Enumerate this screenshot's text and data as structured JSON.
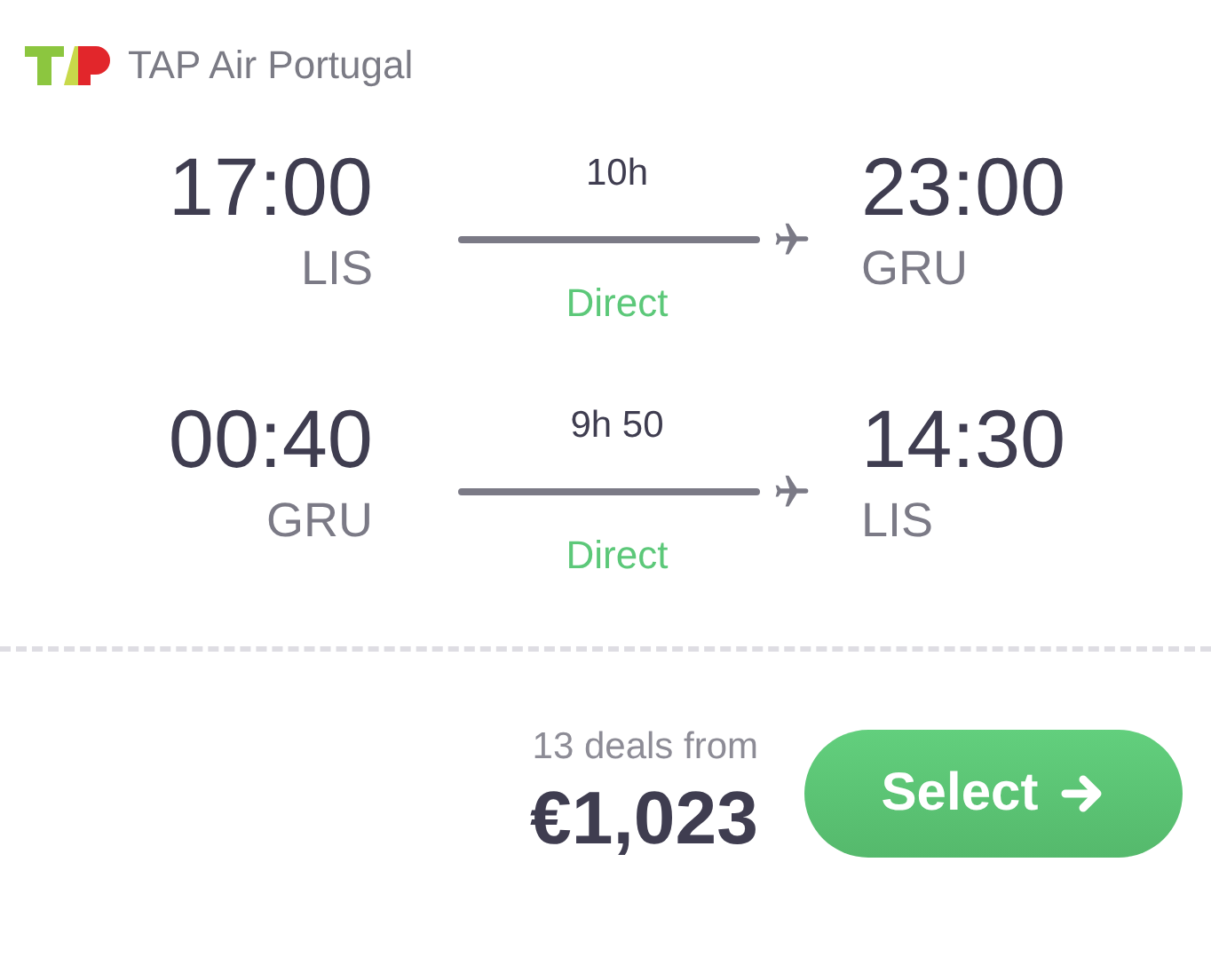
{
  "airline": {
    "name": "TAP Air Portugal"
  },
  "legs": [
    {
      "depart_time": "17:00",
      "depart_airport": "LIS",
      "duration": "10h",
      "stops": "Direct",
      "arrive_time": "23:00",
      "arrive_airport": "GRU"
    },
    {
      "depart_time": "00:40",
      "depart_airport": "GRU",
      "duration": "9h 50",
      "stops": "Direct",
      "arrive_time": "14:30",
      "arrive_airport": "LIS"
    }
  ],
  "price": {
    "deals": "13 deals from",
    "amount": "€1,023"
  },
  "select_button": {
    "label": "Select"
  }
}
